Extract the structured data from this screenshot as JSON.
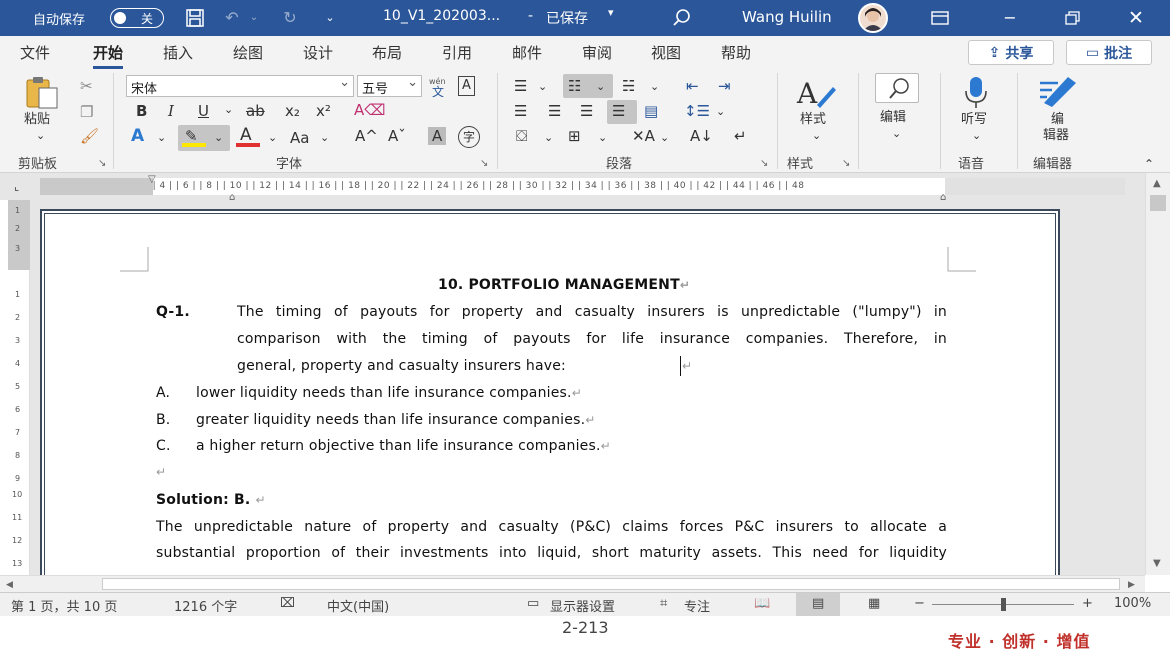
{
  "titlebar": {
    "autosave_label": "自动保存",
    "autosave_state": "关",
    "doc_title": "10_V1_202003...",
    "save_status": "已保存",
    "user_name": "Wang Huilin"
  },
  "tabs": [
    "文件",
    "开始",
    "插入",
    "绘图",
    "设计",
    "布局",
    "引用",
    "邮件",
    "审阅",
    "视图",
    "帮助"
  ],
  "active_tab": "开始",
  "share_button": "共享",
  "comment_button": "批注",
  "ribbon": {
    "clipboard": {
      "paste_label": "粘贴",
      "group_label": "剪贴板"
    },
    "font": {
      "font_name": "宋体",
      "font_size": "五号",
      "group_label": "字体",
      "phonetic": "wén",
      "phonetic_char": "文",
      "char_border": "A",
      "bold": "B",
      "italic": "I",
      "underline": "U",
      "strike": "ab",
      "subscript": "x₂",
      "superscript": "x²",
      "grow": "A^",
      "shrink": "Aˇ",
      "case": "Aa",
      "shade": "A",
      "enclose": "字"
    },
    "paragraph": {
      "group_label": "段落"
    },
    "styles": {
      "label": "样式",
      "group_label": "样式"
    },
    "editing": {
      "label": "编辑"
    },
    "voice": {
      "label": "听写",
      "group_label": "语音"
    },
    "editor": {
      "label1": "编",
      "label2": "辑器",
      "group_label": "编辑器"
    }
  },
  "ruler": {
    "marks": "| 1 4 |  | 1 2 |  | 1 |  | 2 |  | 4 |  | 6 |  | 8 |  | 10 |  | 12 |  | 14 |  | 16 |  | 18 |  | 20 |  | 22 |  | 24 |  | 26 |  | 28 |  | 30 |  | 32 |  | 34 |  | 36 |  | 38 |  | 40 |  | 42 |  | 44 |  | 46 |  | 48"
  },
  "vruler": [
    "1",
    "2",
    "3",
    "1",
    "2",
    "3",
    "4",
    "5",
    "6",
    "7",
    "8",
    "9",
    "10",
    "11",
    "12",
    "13"
  ],
  "document": {
    "heading": "10.  PORTFOLIO MANAGEMENT",
    "question_num": "Q-1.",
    "question_line1": "The timing of payouts for property and casualty insurers is unpredictable (\"lumpy\") in",
    "question_line2": "comparison with the timing of payouts for life insurance companies. Therefore, in",
    "question_line3": "general, property and casualty insurers have:",
    "options": [
      {
        "letter": "A.",
        "text": "lower liquidity needs than life insurance companies."
      },
      {
        "letter": "B.",
        "text": "greater liquidity needs than life insurance companies."
      },
      {
        "letter": "C.",
        "text": "a higher return objective than life insurance companies."
      }
    ],
    "solution": "Solution: B.",
    "solution_line1": "The unpredictable nature of property and casualty (P&C) claims forces P&C insurers to allocate a",
    "solution_line2": "substantial proportion of their investments into liquid, short maturity assets. This need for liquidity",
    "para_mark": "↵"
  },
  "statusbar": {
    "page": "第 1 页，共 10 页",
    "words": "1216 个字",
    "language": "中文(中国)",
    "display_settings": "显示器设置",
    "focus": "专注",
    "zoom": "100%",
    "zoom_minus": "−",
    "zoom_plus": "+"
  },
  "overlay": {
    "page_number": "2-213",
    "slogan": "专业 · 创新 · 增值"
  },
  "colors": {
    "accent": "#2b579a",
    "slogan": "#c0312b",
    "highlight": "#ffe800",
    "font_color": "#e03030"
  }
}
